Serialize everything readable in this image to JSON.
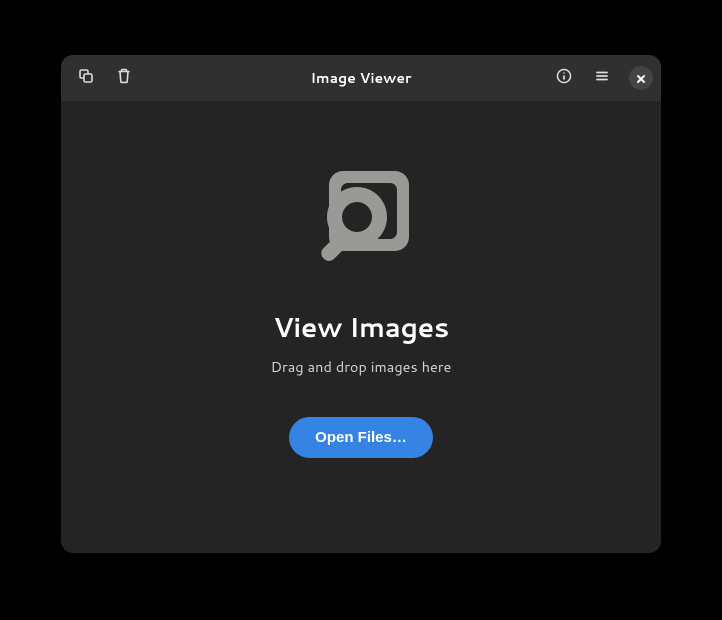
{
  "titlebar": {
    "title": "Image Viewer"
  },
  "empty_state": {
    "heading": "View Images",
    "subtext": "Drag and drop images here",
    "open_button": "Open Files…"
  }
}
